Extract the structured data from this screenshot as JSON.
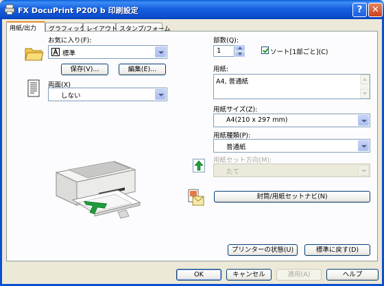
{
  "window": {
    "title": "FX DocuPrint P200 b 印刷設定",
    "help_label": "?",
    "close_label": "✕"
  },
  "tabs": [
    {
      "label": "用紙/出力",
      "active": true
    },
    {
      "label": "グラフィックス",
      "active": false
    },
    {
      "label": "レイアウト",
      "active": false
    },
    {
      "label": "スタンプ/フォーム",
      "active": false
    }
  ],
  "left": {
    "favorites_label": "お気に入り(F):",
    "favorites_value": "標準",
    "save_button": "保存(V)...",
    "edit_button": "編集(E)...",
    "duplex_label": "両面(X)",
    "duplex_value": "しない"
  },
  "right": {
    "copies_label": "部数(Q):",
    "copies_value": "1",
    "collate_label": "ソート[1部ごと](C)",
    "collate_checked": true,
    "paper_label": "用紙:",
    "paper_summary": "A4, 普通紙",
    "paper_size_label": "用紙サイズ(Z):",
    "paper_size_value": "A4(210 x 297 mm)",
    "paper_type_label": "用紙種類(P):",
    "paper_type_value": "普通紙",
    "paper_orient_label": "用紙セット方向(M):",
    "paper_orient_value": "たて",
    "envelope_button": "封筒/用紙セットナビ(N)",
    "printer_status_button": "プリンターの状態(U)",
    "restore_defaults_button": "標準に戻す(D)"
  },
  "footer": {
    "ok": "OK",
    "cancel": "キャンセル",
    "apply": "適用(A)",
    "help": "ヘルプ"
  },
  "colors": {
    "titlebar": "#0b4fd0",
    "dialog_bg": "#ece9d8",
    "panel_bg": "#fcfcfe",
    "arrow_green": "#1e9e3c"
  }
}
